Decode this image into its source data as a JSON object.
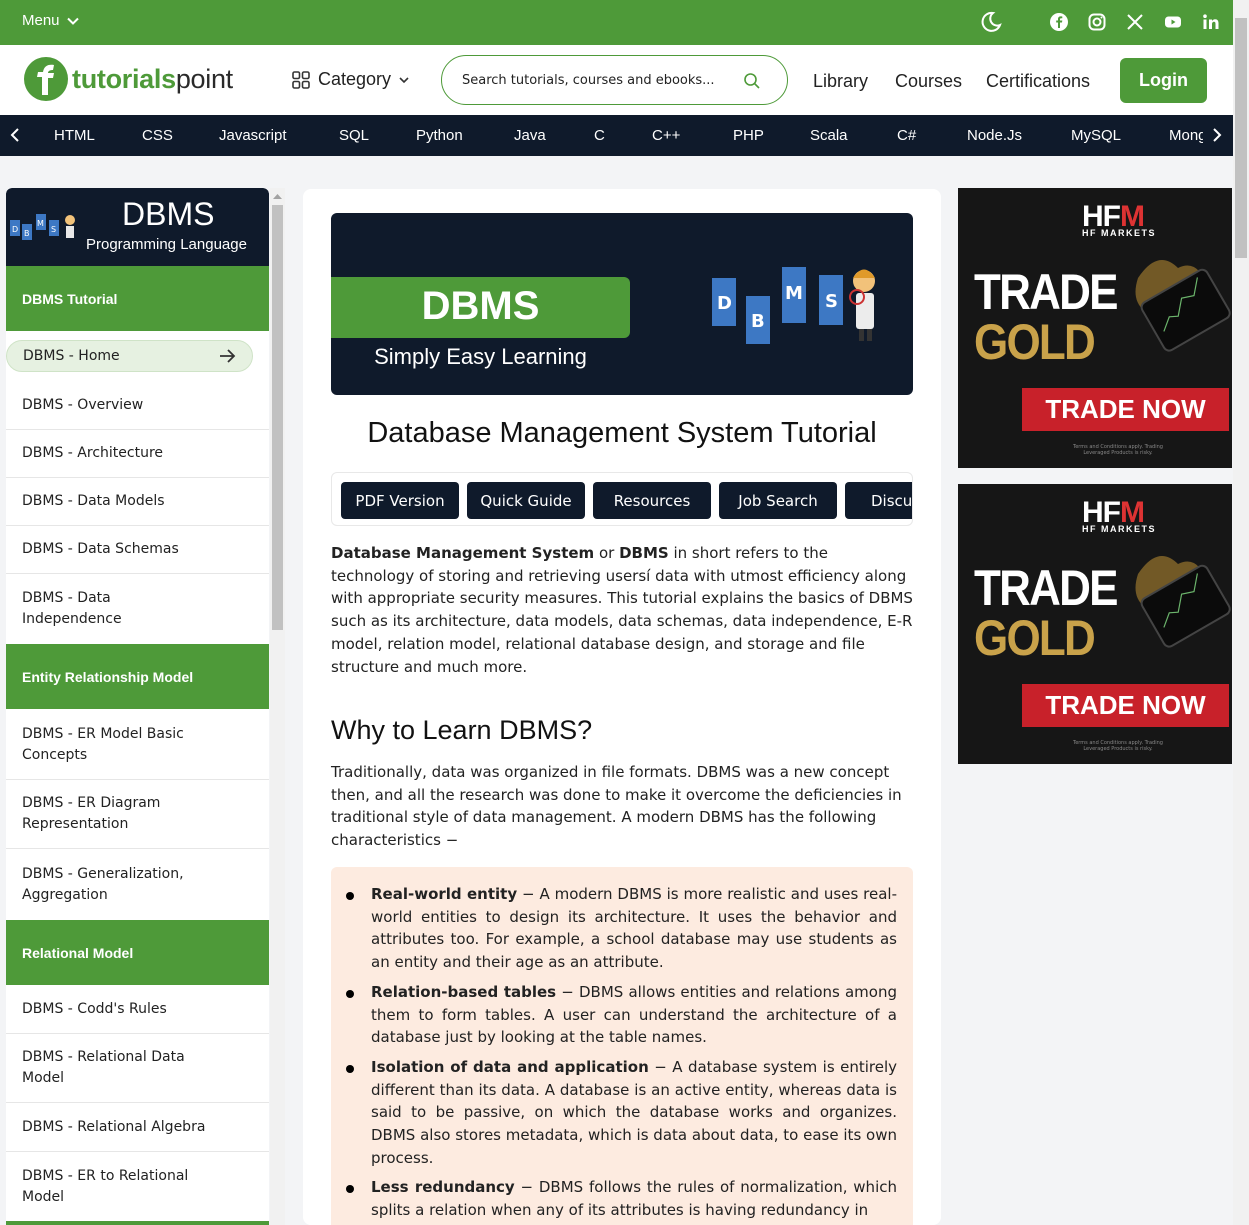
{
  "topbar": {
    "menu_label": "Menu",
    "social_icons": [
      "facebook-icon",
      "instagram-icon",
      "x-icon",
      "youtube-icon",
      "linkedin-icon"
    ],
    "brand_color": "#4e9a39"
  },
  "header": {
    "logo_part1": "tutorials",
    "logo_part2": "point",
    "category_label": "Category",
    "search_placeholder": "Search tutorials, courses and ebooks...",
    "nav": [
      "Library",
      "Courses",
      "Certifications"
    ],
    "login_label": "Login"
  },
  "languages": [
    "HTML",
    "CSS",
    "Javascript",
    "SQL",
    "Python",
    "Java",
    "C",
    "C++",
    "PHP",
    "Scala",
    "C#",
    "Node.Js",
    "MySQL",
    "Mong"
  ],
  "sidebar": {
    "banner_title": "DBMS",
    "banner_subtitle": "Programming Language",
    "sections": [
      {
        "title": "DBMS Tutorial",
        "items": [
          "DBMS - Home",
          "DBMS - Overview",
          "DBMS - Architecture",
          "DBMS - Data Models",
          "DBMS - Data Schemas",
          "DBMS - Data Independence"
        ]
      },
      {
        "title": "Entity Relationship Model",
        "items": [
          "DBMS - ER Model Basic Concepts",
          "DBMS - ER Diagram Representation",
          "DBMS - Generalization, Aggregation"
        ]
      },
      {
        "title": "Relational Model",
        "items": [
          "DBMS - Codd's Rules",
          "DBMS - Relational Data Model",
          "DBMS - Relational Algebra",
          "DBMS - ER to Relational Model"
        ]
      }
    ],
    "active_item": "DBMS - Home"
  },
  "main": {
    "hero_title": "DBMS",
    "hero_subtitle": "Simply Easy Learning",
    "page_title": "Database Management System Tutorial",
    "buttons": [
      "PDF Version",
      "Quick Guide",
      "Resources",
      "Job Search",
      "Discu"
    ],
    "intro_bold1": "Database Management System",
    "intro_or": " or ",
    "intro_bold2": "DBMS",
    "intro_rest": " in short refers to the technology of storing and retrieving usersí data with utmost efficiency along with appropriate security measures. This tutorial explains the basics of DBMS such as its architecture, data models, data schemas, data independence, E-R model, relation model, relational database design, and storage and file structure and much more.",
    "why_heading": "Why to Learn DBMS?",
    "why_text": "Traditionally, data was organized in file formats. DBMS was a new concept then, and all the research was done to make it overcome the deficiencies in traditional style of data management. A modern DBMS has the following characteristics −",
    "characteristics": [
      {
        "term": "Real-world entity",
        "text": " − A modern DBMS is more realistic and uses real-world entities to design its architecture. It uses the behavior and attributes too. For example, a school database may use students as an entity and their age as an attribute."
      },
      {
        "term": "Relation-based tables",
        "text": " − DBMS allows entities and relations among them to form tables. A user can understand the architecture of a database just by looking at the table names."
      },
      {
        "term": "Isolation of data and application",
        "text": " − A database system is entirely different than its data. A database is an active entity, whereas data is said to be passive, on which the database works and organizes. DBMS also stores metadata, which is data about data, to ease its own process."
      },
      {
        "term": "Less redundancy",
        "text": " − DBMS follows the rules of normalization, which splits a relation when any of its attributes is having redundancy in"
      }
    ]
  },
  "ads": [
    {
      "brand_a": "HF",
      "brand_b": "M",
      "sub": "HF MARKETS",
      "line1": "TRADE",
      "line2": "GOLD",
      "cta": "TRADE NOW",
      "fine": "Terms and Conditions apply. Trading Leveraged Products is risky."
    },
    {
      "brand_a": "HF",
      "brand_b": "M",
      "sub": "HF MARKETS",
      "line1": "TRADE",
      "line2": "GOLD",
      "cta": "TRADE NOW",
      "fine": "Terms and Conditions apply. Trading Leveraged Products is risky."
    }
  ]
}
